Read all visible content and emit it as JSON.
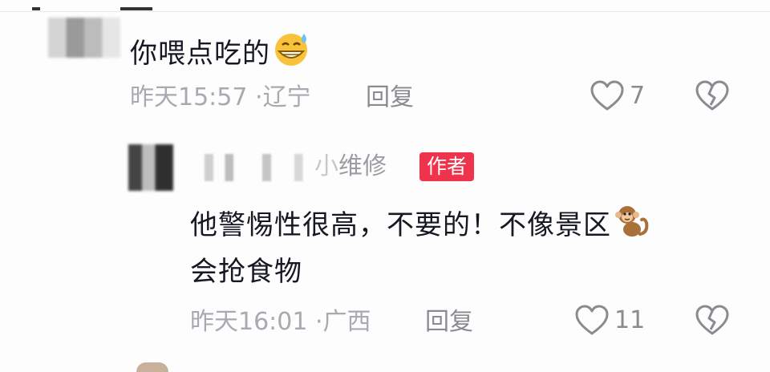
{
  "comments": [
    {
      "text": "你喂点吃的",
      "emoji": "grinning-sweat-emoji",
      "time": "昨天15:57",
      "location": "辽宁",
      "separator": "·",
      "reply_label": "回复",
      "likes": "7"
    },
    {
      "username_visible": "维修",
      "username_partial": "小",
      "badge": "作者",
      "text_line1": "他警惕性很高，不要的！不像景区",
      "text_line2": "会抢食物",
      "emoji": "monkey-emoji",
      "time": "昨天16:01",
      "location": "广西",
      "separator": "·",
      "reply_label": "回复",
      "likes": "11"
    }
  ],
  "colors": {
    "text": "#161823",
    "meta": "#a9aab1",
    "badge": "#f0334c"
  }
}
